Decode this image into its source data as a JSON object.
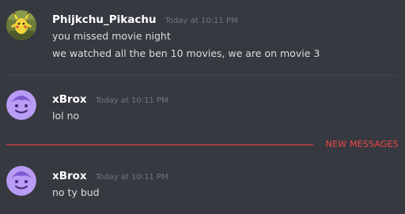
{
  "messages": [
    {
      "username": "Phijkchu_Pikachu",
      "timestamp": "Today at 10:11 PM",
      "avatar": "pikachu-avatar",
      "lines": [
        "you missed movie night",
        "we watched all the ben 10 movies, we are on movie 3"
      ]
    },
    {
      "username": "xBrox",
      "timestamp": "Today at 10:11 PM",
      "avatar": "purple-smile-avatar",
      "lines": [
        "lol no"
      ]
    },
    {
      "username": "xBrox",
      "timestamp": "Today at 10:11 PM",
      "avatar": "purple-smile-avatar",
      "lines": [
        "no ty bud"
      ]
    }
  ],
  "new_messages_label": "NEW MESSAGES",
  "colors": {
    "background": "#36393f",
    "username": "#ffffff",
    "message_text": "#dcddde",
    "timestamp": "#72767d",
    "new_messages": "#f04747",
    "avatar_purple": "#b89cf5"
  }
}
